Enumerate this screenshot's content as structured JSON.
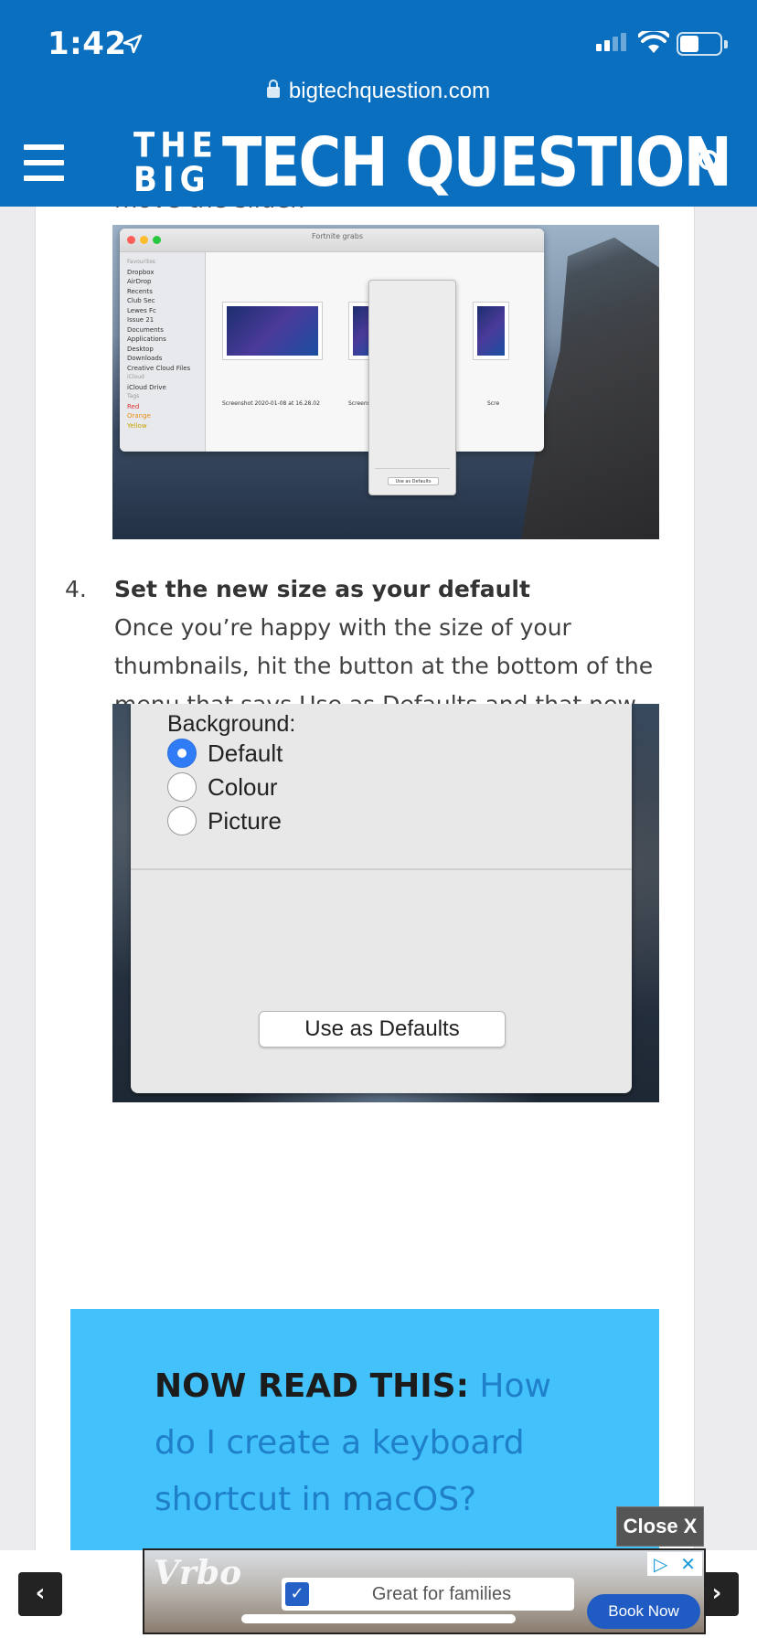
{
  "status_bar": {
    "time": "1:42"
  },
  "browser": {
    "url": "bigtechquestion.com"
  },
  "site": {
    "logo_small_line1": "THE",
    "logo_small_line2": "BIG",
    "logo_main": "TECH QUESTION"
  },
  "article": {
    "cut_text": "move the slider.",
    "screenshot1": {
      "window_title": "Fortnite grabs",
      "sidebar_items": [
        "Favourites",
        "Dropbox",
        "AirDrop",
        "Recents",
        "Club Sec",
        "Lewes Fc",
        "Issue 21",
        "Documents",
        "Applications",
        "Desktop",
        "Downloads",
        "Creative Cloud Files",
        "iCloud",
        "iCloud Drive",
        "Tags",
        "Red",
        "Orange",
        "Yellow"
      ],
      "thumb_caption": "Screenshot 2020-01-08 at 16.28.02",
      "thumb_caption2": "Screenshot",
      "thumb_caption3": "Scre",
      "options_button": "Use as Defaults"
    },
    "step": {
      "number": "4.",
      "heading": "Set the new size as your default",
      "body": "Once you’re happy with the size of your thumbnails, hit the button at the bottom of the menu that says Use as Defaults and that new size will be applied across every folder on your Mac."
    },
    "screenshot2": {
      "background_label": "Background:",
      "options": [
        {
          "label": "Default",
          "selected": true
        },
        {
          "label": "Colour",
          "selected": false
        },
        {
          "label": "Picture",
          "selected": false
        }
      ],
      "button_label": "Use as Defaults"
    },
    "callout": {
      "lead": "NOW READ THIS:",
      "link_text": "How do I create a keyboard shortcut in macOS?"
    }
  },
  "ad": {
    "close_label": "Close X",
    "brand": "Vrbo",
    "tagline": "Great for families",
    "cta": "Book Now"
  },
  "nav": {
    "prev": "‹",
    "next": "›"
  },
  "colors": {
    "brand_blue": "#0b6fbf",
    "callout_bg": "#42c1fb",
    "link": "#1f7fc9"
  }
}
